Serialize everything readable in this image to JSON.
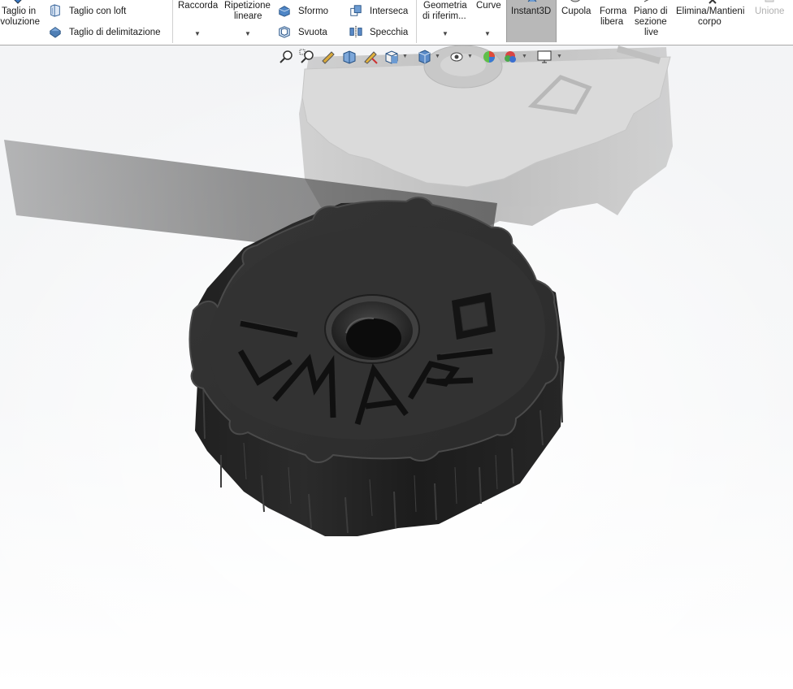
{
  "ribbon": {
    "taglio_rivoluzione": [
      "Taglio in",
      "rivoluzione"
    ],
    "taglio_loft": "Taglio con loft",
    "taglio_delimitazione": "Taglio di delimitazione",
    "raccorda": "Raccorda",
    "ripetizione_lineare": [
      "Ripetizione",
      "lineare"
    ],
    "sformo": "Sformo",
    "svuota": "Svuota",
    "interseca": "Interseca",
    "specchia": "Specchia",
    "geometria_riferimento": [
      "Geometria",
      "di riferim..."
    ],
    "curve": "Curve",
    "instant3d": "Instant3D",
    "cupola": "Cupola",
    "forma_libera": [
      "Forma",
      "libera"
    ],
    "piano_sezione_live": [
      "Piano di",
      "sezione",
      "live"
    ],
    "elimina_mantieni_corpo": [
      "Elimina/Mantieni",
      "corpo"
    ],
    "unione": "Unione"
  },
  "model": {
    "engraved_text": "ILMARIO",
    "letters": [
      "I",
      "L",
      "M",
      "A",
      "R",
      "I",
      "O"
    ]
  },
  "colors": {
    "knob_top": "#2e2e2e",
    "knob_side": "#232323",
    "reflection": "#d4d4d4",
    "active_tab": "#b8b8b8"
  },
  "hud_icons": [
    "zoom-to-fit-icon",
    "zoom-area-icon",
    "previous-view-icon",
    "section-view-icon",
    "dynamic-annotation-icon",
    "view-orientation-icon",
    "display-style-icon",
    "hide-show-items-icon",
    "edit-appearance-icon",
    "apply-scene-icon",
    "view-settings-icon"
  ]
}
